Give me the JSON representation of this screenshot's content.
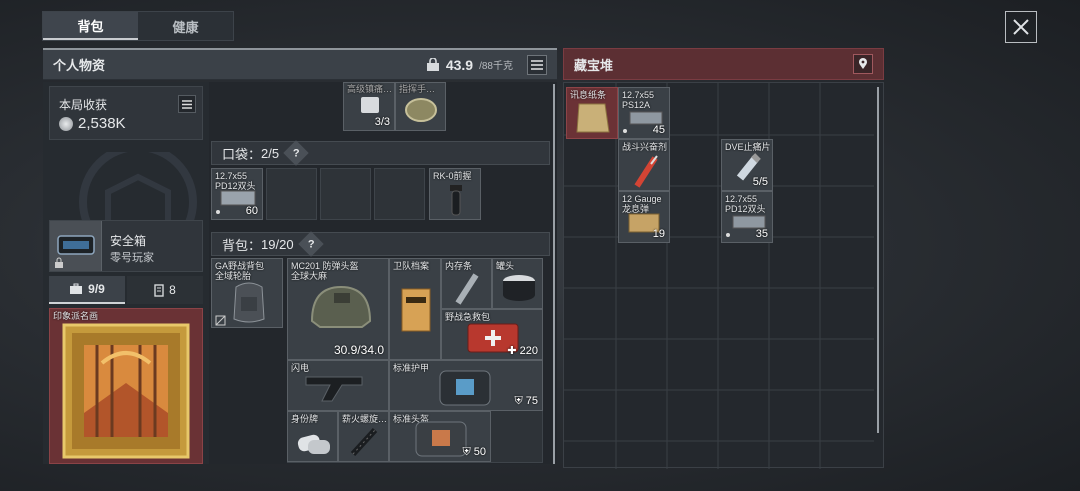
{
  "tabs": [
    {
      "label": "背包"
    },
    {
      "label": "健康"
    }
  ],
  "personal": {
    "title": "个人物资",
    "weight": "43.9",
    "weight_max": "/88千克"
  },
  "loot": {
    "title": "藏宝堆"
  },
  "earnings": {
    "label": "本局收获",
    "value": "2,538K"
  },
  "safebox": {
    "title": "安全箱",
    "subtitle": "零号玩家"
  },
  "quick_tabs": [
    {
      "label": "9/9"
    },
    {
      "label": "8"
    }
  ],
  "painting": {
    "label": "印象派名画"
  },
  "top_items": {
    "left_label": "高级镇痛…",
    "right_label": "指挥手…",
    "count": "3/3"
  },
  "pocket": {
    "title": "口袋：",
    "count": "2/5",
    "help": "?",
    "ammo_label": "12.7x55\nPD12双头",
    "ammo_count": "60",
    "grip_label": "RK-0前握"
  },
  "backpack": {
    "title": "背包：",
    "count": "19/20",
    "help": "?",
    "items": {
      "bag": "GA野战背包\n全域轮胎",
      "helmet": "MC201 防弹头盔\n全球大麻",
      "helmet_dur": "30.9/34.0",
      "file": "卫队档案",
      "strip": "内存条",
      "can": "罐头",
      "medkit": "野战急救包",
      "medkit_count": "220",
      "flash": "闪电",
      "armor": "标准护甲",
      "armor_val": "75",
      "tag": "身份牌",
      "spiral": "薪火螺旋…",
      "helmet2": "标准头盔",
      "helmet2_val": "50"
    }
  },
  "loot_items": {
    "paper": "讯息纸条",
    "ammo1": "12.7x55\nPS12A",
    "ammo1_count": "45",
    "stim": "战斗兴奋剂",
    "dve": "DVE止痛片",
    "dve_count": "5/5",
    "gauge": "12 Gauge\n龙息弹",
    "gauge_count": "19",
    "ammo2": "12.7x55\nPD12双头",
    "ammo2_count": "35"
  }
}
